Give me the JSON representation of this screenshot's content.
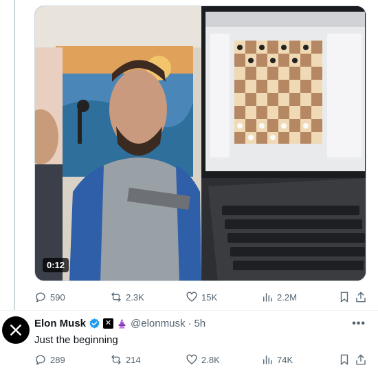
{
  "video": {
    "duration": "0:12"
  },
  "post1_stats": {
    "replies": "590",
    "reposts": "2.3K",
    "likes": "15K",
    "views": "2.2M"
  },
  "post2": {
    "author_name": "Elon Musk",
    "handle": "@elonmusk",
    "separator": "·",
    "time": "5h",
    "text": "Just the beginning",
    "more": "•••",
    "stats": {
      "replies": "289",
      "reposts": "214",
      "likes": "2.8K",
      "views": "74K"
    }
  },
  "colors": {
    "verified": "#1d9bf0",
    "text": "#0f1419",
    "secondary": "#536471",
    "divider": "#eff3f4"
  },
  "icons": [
    "reply-icon",
    "repost-icon",
    "like-icon",
    "views-icon",
    "bookmark-icon",
    "share-icon",
    "verified-icon",
    "x-logo-icon",
    "wizard-emoji-icon"
  ]
}
